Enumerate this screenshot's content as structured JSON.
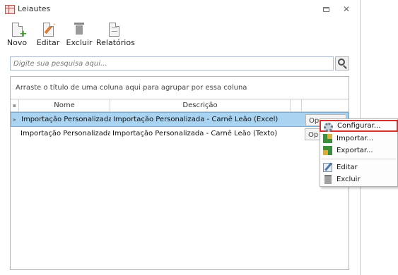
{
  "window": {
    "title": "Leiautes",
    "restore_symbol": "",
    "close_symbol": "✕"
  },
  "toolbar": {
    "new_label": "Novo",
    "edit_label": "Editar",
    "delete_label": "Excluir",
    "reports_label": "Relatórios"
  },
  "search": {
    "placeholder": "Digite sua pesquisa aqui...",
    "value": ""
  },
  "grid": {
    "group_hint": "Arraste o título de uma coluna aqui para agrupar por essa coluna",
    "columns": {
      "nome": "Nome",
      "descricao": "Descrição"
    },
    "rows": [
      {
        "nome": "Importação Personalizada",
        "descricao": "Importação Personalizada - Carnê Leão (Excel)",
        "action": "Op",
        "selected": true
      },
      {
        "nome": "Importação Personalizada",
        "descricao": "Importação Personalizada - Carnê Leão (Texto)",
        "action": "Op",
        "selected": false
      }
    ]
  },
  "context_menu": {
    "configure": "Configurar...",
    "import": "Importar...",
    "export": "Exportar...",
    "edit": "Editar",
    "delete": "Excluir",
    "highlight_color": "#d0312d"
  },
  "colors": {
    "selection": "#a8d4f2",
    "border": "#b5b5b5"
  }
}
